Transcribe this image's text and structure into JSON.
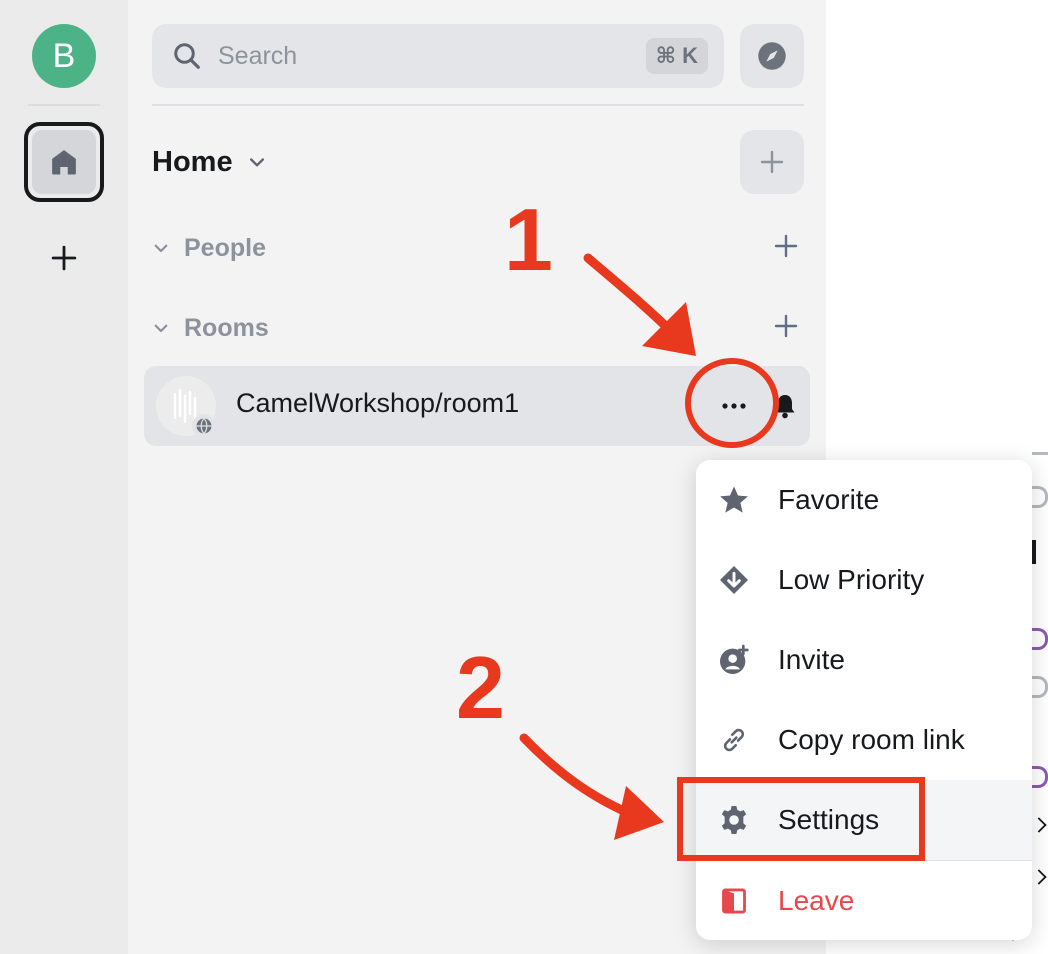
{
  "colors": {
    "accent_avatar": "#4bb385",
    "annotation_red": "#e8391e",
    "danger": "#e5484d",
    "muted": "#8d939c"
  },
  "spacebar": {
    "user_initial": "B",
    "home_icon": "home-icon",
    "add_icon": "plus-icon"
  },
  "search": {
    "placeholder": "Search",
    "shortcut": "⌘ K",
    "explore_icon": "compass-icon"
  },
  "home": {
    "title": "Home",
    "add_icon": "plus-icon"
  },
  "sections": {
    "people": "People",
    "rooms": "Rooms"
  },
  "room": {
    "name": "CamelWorkshop/room1",
    "options_label": "···"
  },
  "context_menu": {
    "items": [
      {
        "label": "Favorite",
        "icon": "star-icon"
      },
      {
        "label": "Low Priority",
        "icon": "arrow-down-icon"
      },
      {
        "label": "Invite",
        "icon": "invite-icon"
      },
      {
        "label": "Copy room link",
        "icon": "link-icon"
      },
      {
        "label": "Settings",
        "icon": "gear-icon"
      },
      {
        "label": "Leave",
        "icon": "leave-icon"
      }
    ]
  },
  "annotations": {
    "step1": "1",
    "step2": "2"
  }
}
